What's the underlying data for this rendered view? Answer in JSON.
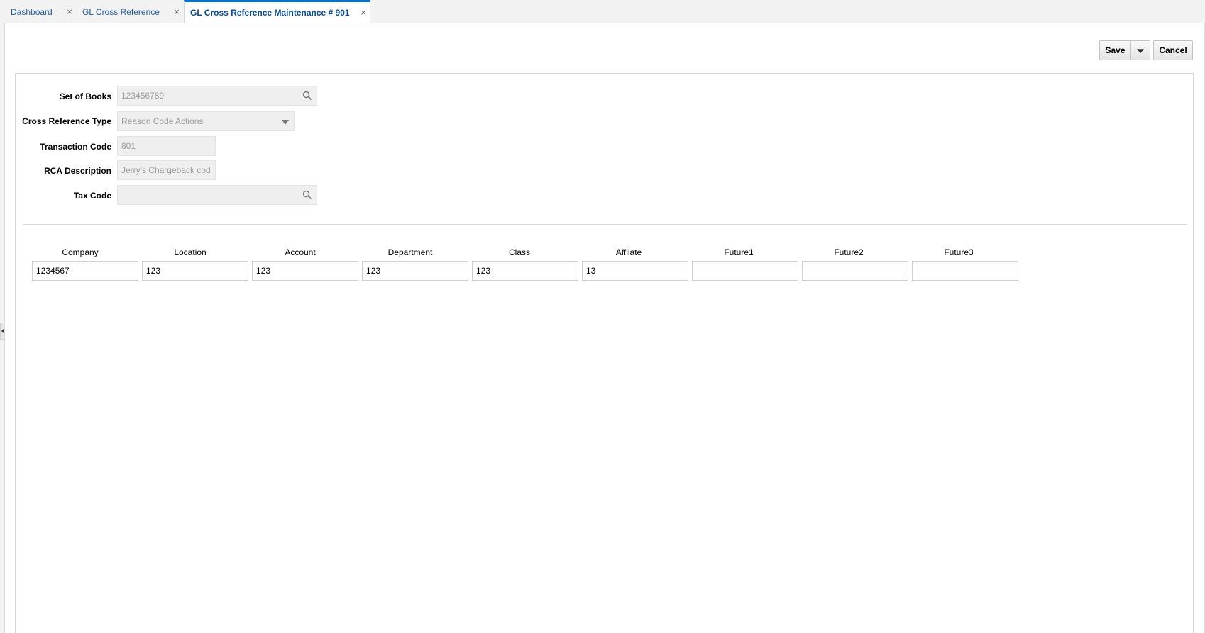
{
  "tabs": [
    {
      "label": "Dashboard",
      "close": "×"
    },
    {
      "label": "GL Cross Reference",
      "close": "×"
    },
    {
      "label": "GL Cross Reference Maintenance # 901",
      "close": "×"
    }
  ],
  "toolbar": {
    "save_label": "Save",
    "cancel_label": "Cancel"
  },
  "form": {
    "set_of_books": {
      "label": "Set of Books",
      "value": "123456789"
    },
    "cross_reference_type": {
      "label": "Cross Reference Type",
      "value": "Reason Code Actions"
    },
    "transaction_code": {
      "label": "Transaction Code",
      "value": "801"
    },
    "rca_description": {
      "label": "RCA Description",
      "value": "Jerry's Chargeback cod"
    },
    "tax_code": {
      "label": "Tax Code",
      "value": ""
    }
  },
  "segments": {
    "headers": [
      "Company",
      "Location",
      "Account",
      "Department",
      "Class",
      "Affliate",
      "Future1",
      "Future2",
      "Future3"
    ],
    "values": [
      "1234567",
      "123",
      "123",
      "123",
      "123",
      "13",
      "",
      "",
      ""
    ]
  },
  "icons": {
    "search": "search-icon",
    "close": "close-icon",
    "dropdown": "chevron-down-icon"
  }
}
